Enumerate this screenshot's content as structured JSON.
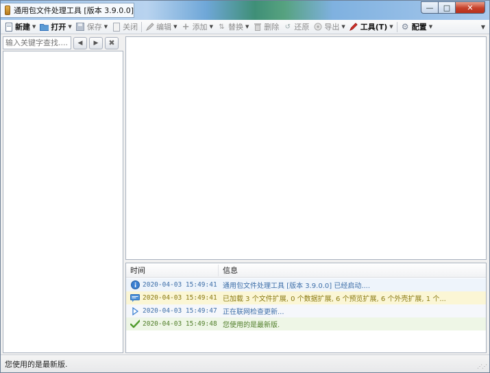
{
  "window": {
    "title": "通用包文件处理工具 [版本 3.9.0.0]",
    "controls": {
      "minimize": "—",
      "maximize": "□",
      "close": "✕"
    }
  },
  "toolbar": {
    "new": "新建",
    "open": "打开",
    "save": "保存",
    "close": "关闭",
    "edit": "编辑",
    "add": "添加",
    "replace": "替换",
    "delete": "删除",
    "restore": "还原",
    "export": "导出",
    "tools": "工具(T)",
    "config": "配置"
  },
  "search": {
    "placeholder": "输入关键字查找....",
    "prev_icon": "triangle-left-icon",
    "next_icon": "triangle-right-icon",
    "clear_icon": "clear-icon"
  },
  "log": {
    "columns": {
      "time": "时间",
      "info": "信息"
    },
    "rows": [
      {
        "icon": "info-icon",
        "time": "2020-04-03 15:49:41",
        "message": "通用包文件处理工具 [版本 3.9.0.0] 已经启动...."
      },
      {
        "icon": "message-icon",
        "time": "2020-04-03 15:49:41",
        "message": "已加载 3 个文件扩展, 0 个数据扩展, 6 个预览扩展, 6 个外壳扩展, 1 个..."
      },
      {
        "icon": "play-icon",
        "time": "2020-04-03 15:49:47",
        "message": "正在联网检查更新..."
      },
      {
        "icon": "check-icon",
        "time": "2020-04-03 15:49:48",
        "message": "您使用的是最新版."
      }
    ]
  },
  "status": {
    "text": "您使用的是最新版."
  },
  "colors": {
    "info": "#3d6ea8",
    "warning": "#8a7a12",
    "success": "#4f7d28",
    "accent": "#2f6fb8"
  }
}
